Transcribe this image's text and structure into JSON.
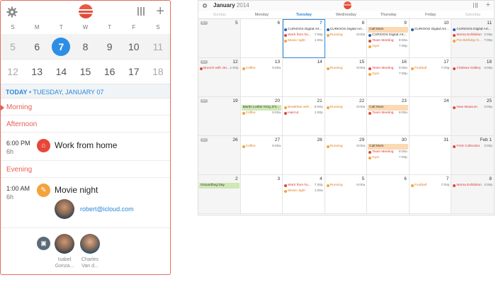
{
  "colors": {
    "accent": "#e85e53",
    "today": "#2c8ee4",
    "link": "#2a86d9",
    "orange": "#f3a33a",
    "red": "#e0473c",
    "green": "#cfe8b5",
    "peach": "#fad9b3"
  },
  "phone": {
    "dow": [
      "S",
      "M",
      "T",
      "W",
      "T",
      "F",
      "S"
    ],
    "week1": [
      "5",
      "6",
      "7",
      "8",
      "9",
      "10",
      "11"
    ],
    "week2": [
      "12",
      "13",
      "14",
      "15",
      "16",
      "17",
      "18"
    ],
    "today_label": "TODAY",
    "today_date": " • TUESDAY, JANUARY 07",
    "sections": {
      "morning": "Morning",
      "afternoon": "Afternoon",
      "evening": "Evening"
    },
    "ev1": {
      "time": "6:00 PM",
      "dur": "6h",
      "title": "Work from home",
      "icon": "home-icon"
    },
    "ev2": {
      "time": "1:00 AM",
      "dur": "6h",
      "title": "Movie night",
      "icon": "ticket-icon",
      "email": "robert@icloud.com"
    },
    "people": [
      {
        "name1": "Isabel",
        "name2": "Gonza..."
      },
      {
        "name1": "Charles",
        "name2": "Van d..."
      }
    ]
  },
  "cal": {
    "month": "January",
    "year": "2014",
    "dow": [
      "Sunday",
      "Monday",
      "Tuesday",
      "Wednesday",
      "Thursday",
      "Friday",
      "Saturday"
    ],
    "weeks": [
      {
        "days": [
          {
            "n": "5",
            "wt": "W 1",
            "ev": []
          },
          {
            "n": "6",
            "ev": []
          },
          {
            "n": "7",
            "today": true,
            "ev": [
              {
                "t": "CURIOOS Digital Art...",
                "c": "#2b5fa7"
              },
              {
                "t": "Work from ho...",
                "tm": "7:00p",
                "c": "#e0473c",
                "cls": "red"
              },
              {
                "t": "Movie night",
                "tm": "1:00a",
                "c": "#f3a33a",
                "cls": "orange"
              }
            ]
          },
          {
            "n": "8",
            "ev": [
              {
                "t": "CURIOOS Digital Art...",
                "c": "#2b5fa7"
              },
              {
                "t": "Running",
                "tm": "8:00a",
                "c": "#f3a33a",
                "cls": "orange"
              }
            ]
          },
          {
            "n": "9",
            "ev": [
              {
                "t": "Call Mom",
                "bar": "#fad9b3"
              },
              {
                "t": "CURIOOS Digital Art...",
                "c": "#2b5fa7"
              },
              {
                "t": "Team Meeting",
                "tm": "9:00a",
                "c": "#e0473c",
                "cls": "red"
              },
              {
                "t": "Gym",
                "tm": "7:00p",
                "c": "#f3a33a",
                "cls": "orange"
              }
            ]
          },
          {
            "n": "10",
            "ev": [
              {
                "t": "CURIOOS Digital Art...",
                "c": "#2b5fa7"
              }
            ]
          },
          {
            "n": "11",
            "ev": [
              {
                "t": "CURIOOS Digital Art...",
                "c": "#2b5fa7"
              },
              {
                "t": "Moma Exhibition",
                "tm": "3:00p",
                "c": "#e0473c",
                "cls": "red"
              },
              {
                "t": "Pre-Birthday D...",
                "tm": "7:00p",
                "c": "#f3a33a",
                "cls": "orange"
              }
            ]
          }
        ]
      },
      {
        "days": [
          {
            "n": "12",
            "wt": "W 2",
            "ev": [
              {
                "t": "Brunch with Jer...",
                "tm": "1:00p",
                "c": "#e0473c",
                "cls": "red"
              }
            ]
          },
          {
            "n": "13",
            "ev": [
              {
                "t": "Coffee",
                "tm": "9:00a",
                "c": "#f3a33a",
                "cls": "orange"
              }
            ]
          },
          {
            "n": "14",
            "ev": []
          },
          {
            "n": "15",
            "ev": [
              {
                "t": "Running",
                "tm": "8:00a",
                "c": "#f3a33a",
                "cls": "orange"
              }
            ]
          },
          {
            "n": "16",
            "ev": [
              {
                "t": "Team Meeting",
                "tm": "9:00a",
                "c": "#e0473c",
                "cls": "red"
              },
              {
                "t": "Gym",
                "tm": "7:00p",
                "c": "#f3a33a",
                "cls": "orange"
              }
            ]
          },
          {
            "n": "17",
            "ev": [
              {
                "t": "Football",
                "tm": "7:00p",
                "c": "#f3a33a",
                "cls": "orange"
              }
            ]
          },
          {
            "n": "18",
            "ev": [
              {
                "t": "Chelsea Gallery",
                "tm": "3:00p",
                "c": "#e0473c",
                "cls": "red"
              }
            ]
          }
        ]
      },
      {
        "days": [
          {
            "n": "19",
            "wt": "W 3",
            "ev": []
          },
          {
            "n": "20",
            "ev": [
              {
                "t": "Martin Luther King Jr's...",
                "bar": "#cfe8b5"
              },
              {
                "t": "Coffee",
                "tm": "9:00a",
                "c": "#f3a33a",
                "cls": "orange"
              }
            ]
          },
          {
            "n": "21",
            "ev": [
              {
                "t": "Breakfast with...",
                "tm": "8:00a",
                "c": "#f3a33a",
                "cls": "orange"
              },
              {
                "t": "Haircut",
                "tm": "1:00p",
                "c": "#e0473c",
                "cls": "red"
              }
            ]
          },
          {
            "n": "22",
            "ev": [
              {
                "t": "Running",
                "tm": "8:00a",
                "c": "#f3a33a",
                "cls": "orange"
              }
            ]
          },
          {
            "n": "23",
            "ev": [
              {
                "t": "Call Mom",
                "bar": "#fad9b3"
              },
              {
                "t": "Team Meeting",
                "tm": "9:00a",
                "c": "#e0473c",
                "cls": "red"
              }
            ]
          },
          {
            "n": "24",
            "ev": []
          },
          {
            "n": "25",
            "ev": [
              {
                "t": "New Museum",
                "tm": "3:00p",
                "c": "#e0473c",
                "cls": "red"
              }
            ]
          }
        ]
      },
      {
        "days": [
          {
            "n": "26",
            "wt": "W 4",
            "ev": []
          },
          {
            "n": "27",
            "ev": [
              {
                "t": "Coffee",
                "tm": "9:00a",
                "c": "#f3a33a",
                "cls": "orange"
              }
            ]
          },
          {
            "n": "28",
            "ev": []
          },
          {
            "n": "29",
            "ev": [
              {
                "t": "Running",
                "tm": "8:00a",
                "c": "#f3a33a",
                "cls": "orange"
              }
            ]
          },
          {
            "n": "30",
            "ev": [
              {
                "t": "Call Mom",
                "bar": "#fad9b3"
              },
              {
                "t": "Team Meeting",
                "tm": "9:00a",
                "c": "#e0473c",
                "cls": "red"
              },
              {
                "t": "Gym",
                "tm": "7:00p",
                "c": "#f3a33a",
                "cls": "orange"
              }
            ]
          },
          {
            "n": "31",
            "ev": []
          },
          {
            "n": "Feb 1",
            "ev": [
              {
                "t": "Frick Collection",
                "tm": "3:00p",
                "c": "#e0473c",
                "cls": "red"
              }
            ]
          }
        ]
      },
      {
        "days": [
          {
            "n": "2",
            "ev": [
              {
                "t": "Groundhog Day",
                "bar": "#cfe8b5"
              }
            ]
          },
          {
            "n": "3",
            "ev": []
          },
          {
            "n": "4",
            "ev": [
              {
                "t": "Work from ho...",
                "tm": "7:00p",
                "c": "#e0473c",
                "cls": "red"
              },
              {
                "t": "Movie night",
                "tm": "1:00a",
                "c": "#f3a33a",
                "cls": "orange"
              }
            ]
          },
          {
            "n": "5",
            "ev": [
              {
                "t": "Running",
                "tm": "8:00a",
                "c": "#f3a33a",
                "cls": "orange"
              }
            ]
          },
          {
            "n": "6",
            "ev": []
          },
          {
            "n": "7",
            "ev": [
              {
                "t": "Football",
                "tm": "7:00p",
                "c": "#f3a33a",
                "cls": "orange"
              }
            ]
          },
          {
            "n": "8",
            "ev": [
              {
                "t": "Moma Exhibition",
                "tm": "3:00p",
                "c": "#e0473c",
                "cls": "red"
              }
            ]
          }
        ]
      }
    ]
  }
}
